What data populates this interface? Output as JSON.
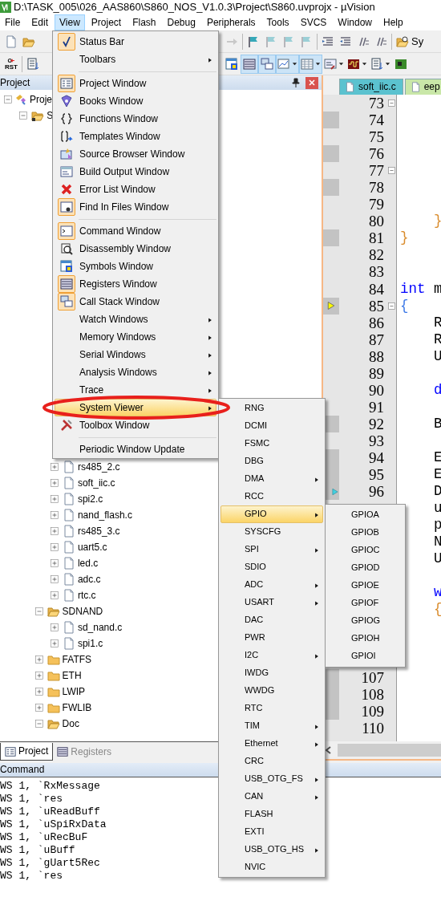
{
  "window": {
    "title": "D:\\TASK_005\\026_AAS860\\S860_NOS_V1.0.3\\Project\\S860.uvprojx - µVision"
  },
  "menubar": [
    {
      "label": "File",
      "selected": false
    },
    {
      "label": "Edit",
      "selected": false
    },
    {
      "label": "View",
      "selected": true
    },
    {
      "label": "Project",
      "selected": false
    },
    {
      "label": "Flash",
      "selected": false
    },
    {
      "label": "Debug",
      "selected": false
    },
    {
      "label": "Peripherals",
      "selected": false
    },
    {
      "label": "Tools",
      "selected": false
    },
    {
      "label": "SVCS",
      "selected": false
    },
    {
      "label": "Window",
      "selected": false
    },
    {
      "label": "Help",
      "selected": false
    }
  ],
  "toolbars": [
    {
      "left": [
        {
          "kind": "new-file",
          "selected": false,
          "disabled": false
        },
        {
          "kind": "open",
          "selected": false,
          "disabled": false
        }
      ],
      "right": [
        {
          "kind": "redo",
          "selected": false,
          "disabled": true
        },
        {
          "kind": "sep"
        },
        {
          "kind": "flag",
          "selected": false,
          "disabled": false
        },
        {
          "kind": "flag",
          "selected": false,
          "disabled": true
        },
        {
          "kind": "flag",
          "selected": false,
          "disabled": true
        },
        {
          "kind": "flag",
          "selected": false,
          "disabled": true
        },
        {
          "kind": "sep"
        },
        {
          "kind": "indent",
          "selected": false,
          "disabled": false
        },
        {
          "kind": "outdent",
          "selected": false,
          "disabled": false
        },
        {
          "kind": "comment",
          "selected": false,
          "disabled": false
        },
        {
          "kind": "comment",
          "selected": false,
          "disabled": false
        },
        {
          "kind": "sep"
        },
        {
          "kind": "find-files",
          "selected": false,
          "disabled": false
        },
        {
          "kind": "text",
          "label": "Sy"
        }
      ]
    },
    {
      "left": [
        {
          "kind": "reset",
          "label": "RST",
          "selected": false,
          "disabled": false
        },
        {
          "kind": "sep"
        },
        {
          "kind": "list",
          "selected": false,
          "disabled": false
        }
      ],
      "right": [
        {
          "kind": "symbols",
          "selected": false,
          "disabled": false
        },
        {
          "kind": "registers",
          "selected": true,
          "disabled": false
        },
        {
          "kind": "call-stack",
          "selected": true,
          "disabled": false
        },
        {
          "kind": "watch",
          "selected": true,
          "disabled": false,
          "dropdown": true
        },
        {
          "kind": "memory",
          "selected": true,
          "disabled": false,
          "dropdown": true
        },
        {
          "kind": "serial",
          "selected": false,
          "disabled": false,
          "dropdown": true
        },
        {
          "kind": "logic",
          "selected": false,
          "disabled": false,
          "dropdown": true
        },
        {
          "kind": "list",
          "selected": false,
          "disabled": false,
          "dropdown": true
        },
        {
          "kind": "board",
          "selected": false,
          "disabled": false
        }
      ]
    }
  ],
  "project_pane": {
    "title": "Project",
    "tree": [
      {
        "label": "Proje",
        "kind": "project",
        "expanded": true,
        "children": [
          {
            "label": "S",
            "kind": "target",
            "expanded": true,
            "children": [
              {
                "children": [
                  {
                    "label": "rs485_2.c",
                    "kind": "file",
                    "expanded": false
                  },
                  {
                    "label": "soft_iic.c",
                    "kind": "file",
                    "expanded": false
                  },
                  {
                    "label": "spi2.c",
                    "kind": "file",
                    "expanded": false
                  },
                  {
                    "label": "nand_flash.c",
                    "kind": "file",
                    "expanded": false
                  },
                  {
                    "label": "rs485_3.c",
                    "kind": "file",
                    "expanded": false
                  },
                  {
                    "label": "uart5.c",
                    "kind": "file",
                    "expanded": false
                  },
                  {
                    "label": "led.c",
                    "kind": "file",
                    "expanded": false
                  },
                  {
                    "label": "adc.c",
                    "kind": "file",
                    "expanded": false
                  },
                  {
                    "label": "rtc.c",
                    "kind": "file",
                    "expanded": false
                  }
                ]
              },
              {
                "label": "SDNAND",
                "kind": "folder",
                "expanded": true,
                "children": [
                  {
                    "label": "sd_nand.c",
                    "kind": "file",
                    "expanded": false
                  },
                  {
                    "label": "spi1.c",
                    "kind": "file",
                    "expanded": false
                  }
                ]
              },
              {
                "label": "FATFS",
                "kind": "folder",
                "expanded": false
              },
              {
                "label": "ETH",
                "kind": "folder",
                "expanded": false
              },
              {
                "label": "LWIP",
                "kind": "folder",
                "expanded": false
              },
              {
                "label": "FWLIB",
                "kind": "folder",
                "expanded": false
              },
              {
                "label": "Doc",
                "kind": "folder",
                "expanded": true
              }
            ]
          }
        ]
      }
    ],
    "tabs": [
      {
        "label": "Project",
        "selected": true
      },
      {
        "label": "Registers",
        "selected": false
      }
    ]
  },
  "editor": {
    "tabs": [
      {
        "label": "soft_iic.c",
        "selected": true
      },
      {
        "label": "eep",
        "selected": false
      }
    ],
    "lines": [
      {
        "number": "73",
        "fold_start": true,
        "exec": false
      },
      {
        "number": "74",
        "fold_start": false,
        "exec": true
      },
      {
        "number": "75",
        "fold_start": false,
        "exec": false
      },
      {
        "number": "76",
        "fold_start": false,
        "exec": true
      },
      {
        "number": "77",
        "fold_start": true,
        "exec": false
      },
      {
        "number": "78",
        "fold_start": false,
        "exec": true
      },
      {
        "number": "79",
        "fold_start": false,
        "exec": false
      },
      {
        "number": "80",
        "fold_start": false,
        "exec": false,
        "code": [
          {
            "text": "    }",
            "kind": "brace"
          }
        ]
      },
      {
        "number": "81",
        "fold_start": false,
        "exec": true,
        "code": [
          {
            "text": "}",
            "kind": "brace"
          }
        ]
      },
      {
        "number": "82",
        "fold_start": false,
        "exec": false
      },
      {
        "number": "83",
        "fold_start": false,
        "exec": false
      },
      {
        "number": "84",
        "fold_start": false,
        "exec": false,
        "code": [
          {
            "text": "int",
            "kind": "keyword"
          },
          {
            "text": " m",
            "kind": "plain"
          }
        ]
      },
      {
        "number": "85",
        "fold_start": true,
        "exec": true,
        "current": true,
        "code": [
          {
            "text": "{",
            "kind": "block"
          }
        ]
      },
      {
        "number": "86",
        "fold_start": false,
        "exec": false,
        "code": [
          {
            "text": "    R",
            "kind": "plain"
          }
        ]
      },
      {
        "number": "87",
        "fold_start": false,
        "exec": false,
        "code": [
          {
            "text": "    R",
            "kind": "plain"
          }
        ]
      },
      {
        "number": "88",
        "fold_start": false,
        "exec": false,
        "code": [
          {
            "text": "    U",
            "kind": "plain"
          }
        ]
      },
      {
        "number": "89",
        "fold_start": false,
        "exec": false
      },
      {
        "number": "90",
        "fold_start": false,
        "exec": false,
        "code": [
          {
            "text": "    d",
            "kind": "keyword"
          }
        ]
      },
      {
        "number": "91",
        "fold_start": false,
        "exec": false
      },
      {
        "number": "92",
        "fold_start": false,
        "exec": true,
        "code": [
          {
            "text": "    B",
            "kind": "plain"
          }
        ]
      },
      {
        "number": "93",
        "fold_start": false,
        "exec": false
      },
      {
        "number": "94",
        "fold_start": false,
        "exec": true,
        "code": [
          {
            "text": "    E",
            "kind": "plain"
          }
        ]
      },
      {
        "number": "95",
        "fold_start": false,
        "exec": true,
        "code": [
          {
            "text": "    E",
            "kind": "plain"
          }
        ]
      },
      {
        "number": "96",
        "fold_start": false,
        "exec": true,
        "cursor": true,
        "code": [
          {
            "text": "    D",
            "kind": "plain"
          }
        ]
      },
      {
        "code": [
          {
            "text": "    u",
            "kind": "plain"
          }
        ]
      },
      {
        "code": [
          {
            "text": "    p",
            "kind": "plain"
          }
        ]
      },
      {
        "code": [
          {
            "text": "    N",
            "kind": "plain"
          }
        ]
      },
      {
        "code": [
          {
            "text": "    U",
            "kind": "plain"
          }
        ]
      },
      {
        "code": [
          {
            "text": "    w",
            "kind": "keyword"
          }
        ]
      },
      {
        "code": [
          {
            "text": "    {",
            "kind": "brace"
          }
        ]
      },
      {
        "number": "107",
        "fold_start": false,
        "exec": true
      },
      {
        "number": "108",
        "fold_start": false,
        "exec": true
      },
      {
        "number": "109",
        "fold_start": false,
        "exec": true
      },
      {
        "number": "110",
        "fold_start": false,
        "exec": false
      }
    ]
  },
  "command": {
    "title": "Command",
    "lines": [
      "WS 1, `RxMessage",
      "WS 1, `res",
      "WS 1, `uReadBuff",
      "WS 1, `uSpiRxData",
      "WS 1, `uRecBuF",
      "WS 1, `uBuff",
      "WS 1, `gUart5Rec",
      "WS 1, `res"
    ]
  },
  "view_menu": [
    {
      "kind": "item",
      "label": "Status Bar",
      "checked": true,
      "submenu": false,
      "selected": false
    },
    {
      "kind": "item",
      "label": "Toolbars",
      "checked": false,
      "submenu": true,
      "selected": false
    },
    {
      "kind": "separator"
    },
    {
      "kind": "item",
      "label": "Project Window",
      "checked": true,
      "submenu": false,
      "selected": false
    },
    {
      "kind": "item",
      "label": "Books Window",
      "checked": false,
      "submenu": false,
      "selected": false
    },
    {
      "kind": "item",
      "label": "Functions Window",
      "checked": false,
      "submenu": false,
      "selected": false
    },
    {
      "kind": "item",
      "label": "Templates Window",
      "checked": false,
      "submenu": false,
      "selected": false
    },
    {
      "kind": "item",
      "label": "Source Browser Window",
      "checked": false,
      "submenu": false,
      "selected": false
    },
    {
      "kind": "item",
      "label": "Build Output Window",
      "checked": false,
      "submenu": false,
      "selected": false
    },
    {
      "kind": "item",
      "label": "Error List Window",
      "checked": false,
      "submenu": false,
      "selected": false
    },
    {
      "kind": "item",
      "label": "Find In Files Window",
      "checked": true,
      "submenu": false,
      "selected": false
    },
    {
      "kind": "separator"
    },
    {
      "kind": "item",
      "label": "Command Window",
      "checked": true,
      "submenu": false,
      "selected": false
    },
    {
      "kind": "item",
      "label": "Disassembly Window",
      "checked": false,
      "submenu": false,
      "selected": false
    },
    {
      "kind": "item",
      "label": "Symbols Window",
      "checked": false,
      "submenu": false,
      "selected": false
    },
    {
      "kind": "item",
      "label": "Registers Window",
      "checked": true,
      "submenu": false,
      "selected": false
    },
    {
      "kind": "item",
      "label": "Call Stack Window",
      "checked": true,
      "submenu": false,
      "selected": false
    },
    {
      "kind": "item",
      "label": "Watch Windows",
      "checked": false,
      "submenu": true,
      "selected": false
    },
    {
      "kind": "item",
      "label": "Memory Windows",
      "checked": false,
      "submenu": true,
      "selected": false
    },
    {
      "kind": "item",
      "label": "Serial Windows",
      "checked": false,
      "submenu": true,
      "selected": false
    },
    {
      "kind": "item",
      "label": "Analysis Windows",
      "checked": false,
      "submenu": true,
      "selected": false
    },
    {
      "kind": "item",
      "label": "Trace",
      "checked": false,
      "submenu": true,
      "selected": false
    },
    {
      "kind": "item",
      "label": "System Viewer",
      "checked": false,
      "submenu": true,
      "selected": true
    },
    {
      "kind": "item",
      "label": "Toolbox Window",
      "checked": false,
      "submenu": false,
      "selected": false
    },
    {
      "kind": "separator"
    },
    {
      "kind": "item",
      "label": "Periodic Window Update",
      "checked": false,
      "submenu": false,
      "selected": false
    }
  ],
  "system_viewer_menu": [
    {
      "label": "RNG",
      "submenu": false,
      "selected": false
    },
    {
      "label": "DCMI",
      "submenu": false,
      "selected": false
    },
    {
      "label": "FSMC",
      "submenu": false,
      "selected": false
    },
    {
      "label": "DBG",
      "submenu": false,
      "selected": false
    },
    {
      "label": "DMA",
      "submenu": true,
      "selected": false
    },
    {
      "label": "RCC",
      "submenu": false,
      "selected": false
    },
    {
      "label": "GPIO",
      "submenu": true,
      "selected": true
    },
    {
      "label": "SYSCFG",
      "submenu": false,
      "selected": false
    },
    {
      "label": "SPI",
      "submenu": true,
      "selected": false
    },
    {
      "label": "SDIO",
      "submenu": false,
      "selected": false
    },
    {
      "label": "ADC",
      "submenu": true,
      "selected": false
    },
    {
      "label": "USART",
      "submenu": true,
      "selected": false
    },
    {
      "label": "DAC",
      "submenu": false,
      "selected": false
    },
    {
      "label": "PWR",
      "submenu": false,
      "selected": false
    },
    {
      "label": "I2C",
      "submenu": true,
      "selected": false
    },
    {
      "label": "IWDG",
      "submenu": false,
      "selected": false
    },
    {
      "label": "WWDG",
      "submenu": false,
      "selected": false
    },
    {
      "label": "RTC",
      "submenu": false,
      "selected": false
    },
    {
      "label": "TIM",
      "submenu": true,
      "selected": false
    },
    {
      "label": "Ethernet",
      "submenu": true,
      "selected": false
    },
    {
      "label": "CRC",
      "submenu": false,
      "selected": false
    },
    {
      "label": "USB_OTG_FS",
      "submenu": true,
      "selected": false
    },
    {
      "label": "CAN",
      "submenu": true,
      "selected": false
    },
    {
      "label": "FLASH",
      "submenu": false,
      "selected": false
    },
    {
      "label": "EXTI",
      "submenu": false,
      "selected": false
    },
    {
      "label": "USB_OTG_HS",
      "submenu": true,
      "selected": false
    },
    {
      "label": "NVIC",
      "submenu": false,
      "selected": false
    }
  ],
  "gpio_menu": [
    {
      "label": "GPIOA",
      "selected": false
    },
    {
      "label": "GPIOB",
      "selected": false
    },
    {
      "label": "GPIOC",
      "selected": false
    },
    {
      "label": "GPIOD",
      "selected": false
    },
    {
      "label": "GPIOE",
      "selected": false
    },
    {
      "label": "GPIOF",
      "selected": false
    },
    {
      "label": "GPIOG",
      "selected": false
    },
    {
      "label": "GPIOH",
      "selected": false
    },
    {
      "label": "GPIOI",
      "selected": false
    }
  ]
}
